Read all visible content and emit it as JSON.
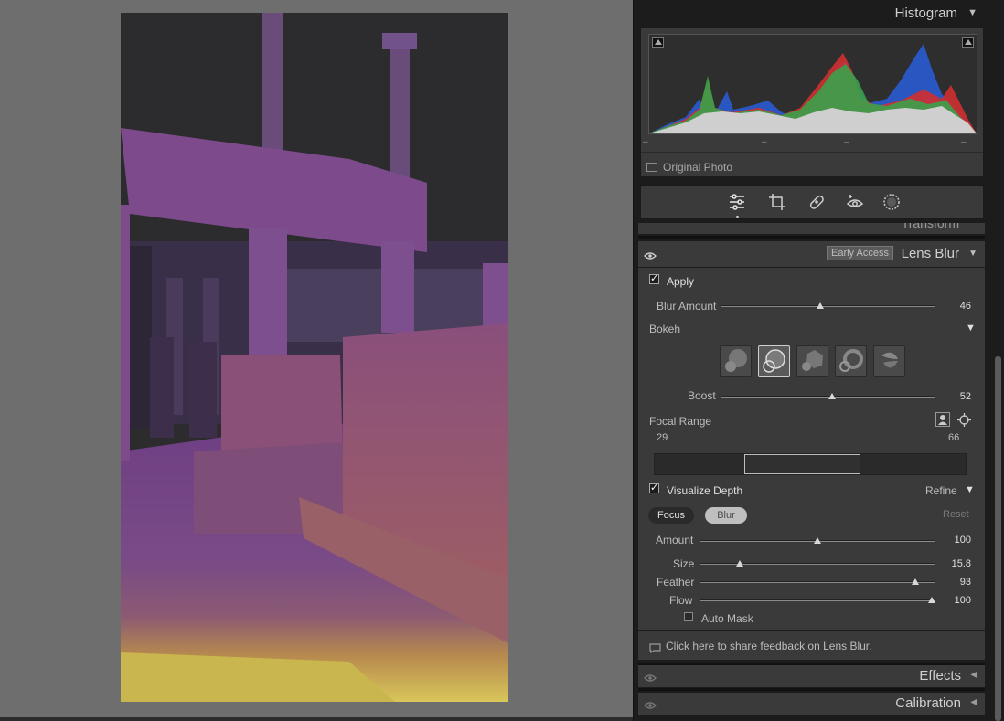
{
  "histogram": {
    "title": "Histogram",
    "dashes": [
      "–",
      "–",
      "–",
      "–"
    ],
    "original_photo_label": "Original Photo"
  },
  "tools": [
    "edit-sliders-icon",
    "crop-icon",
    "healing-icon",
    "redeye-icon",
    "masking-icon"
  ],
  "transform_peek": "Transform",
  "lens_blur": {
    "early_access": "Early Access",
    "title": "Lens Blur",
    "apply_label": "Apply",
    "apply_checked": true,
    "blur_amount_label": "Blur Amount",
    "blur_amount_value": "46",
    "bokeh_label": "Bokeh",
    "boost_label": "Boost",
    "boost_value": "52",
    "focal_range_label": "Focal Range",
    "focal_min": "29",
    "focal_max": "66",
    "visualize_depth_label": "Visualize Depth",
    "visualize_checked": true,
    "refine_label": "Refine",
    "focus_label": "Focus",
    "blur_label": "Blur",
    "reset_label": "Reset",
    "amount_label": "Amount",
    "amount_value": "100",
    "size_label": "Size",
    "size_value": "15.8",
    "feather_label": "Feather",
    "feather_value": "93",
    "flow_label": "Flow",
    "flow_value": "100",
    "auto_mask_label": "Auto Mask",
    "auto_mask_checked": false
  },
  "feedback": "Click here to share feedback on Lens Blur.",
  "effects": "Effects",
  "calibration": "Calibration",
  "colors": {
    "panel_bg": "#3a3a3a",
    "depth_purple": "#7a4a8c",
    "depth_yellow": "#d8c25a"
  }
}
